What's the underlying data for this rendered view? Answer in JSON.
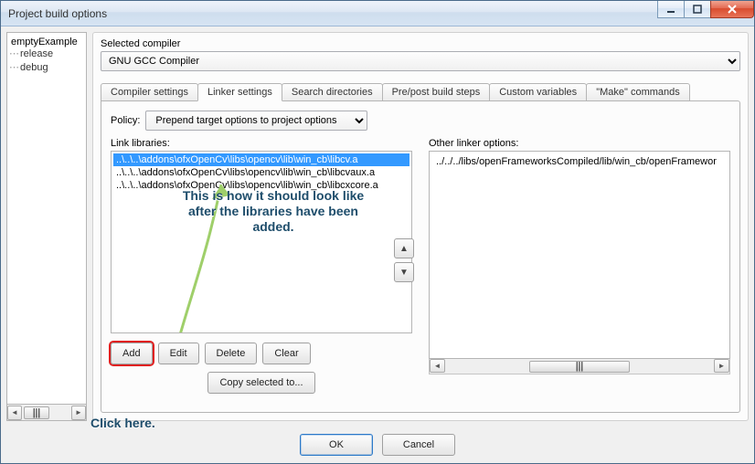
{
  "window": {
    "title": "Project build options"
  },
  "win_controls": {
    "min": "minimize",
    "max": "maximize",
    "close": "close"
  },
  "tree": {
    "root": "emptyExample",
    "children": [
      "release",
      "debug"
    ]
  },
  "selected_compiler_label": "Selected compiler",
  "compiler": "GNU GCC Compiler",
  "tabs": [
    {
      "label": "Compiler settings"
    },
    {
      "label": "Linker settings"
    },
    {
      "label": "Search directories"
    },
    {
      "label": "Pre/post build steps"
    },
    {
      "label": "Custom variables"
    },
    {
      "label": "\"Make\" commands"
    }
  ],
  "active_tab_index": 1,
  "policy_label": "Policy:",
  "policy_value": "Prepend target options to project options",
  "link_libs_label": "Link libraries:",
  "link_libs": [
    "..\\..\\..\\addons\\ofxOpenCv\\libs\\opencv\\lib\\win_cb\\libcv.a",
    "..\\..\\..\\addons\\ofxOpenCv\\libs\\opencv\\lib\\win_cb\\libcvaux.a",
    "..\\..\\..\\addons\\ofxOpenCv\\libs\\opencv\\lib\\win_cb\\libcxcore.a"
  ],
  "other_label": "Other linker options:",
  "other_value": "../../../libs/openFrameworksCompiled/lib/win_cb/openFramewor",
  "buttons": {
    "add": "Add",
    "edit": "Edit",
    "delete": "Delete",
    "clear": "Clear",
    "copy": "Copy selected to...",
    "ok": "OK",
    "cancel": "Cancel"
  },
  "annotations": {
    "main": "This is how it should look like after the libraries have been added.",
    "click": "Click here."
  },
  "scroll_grip": "|||"
}
